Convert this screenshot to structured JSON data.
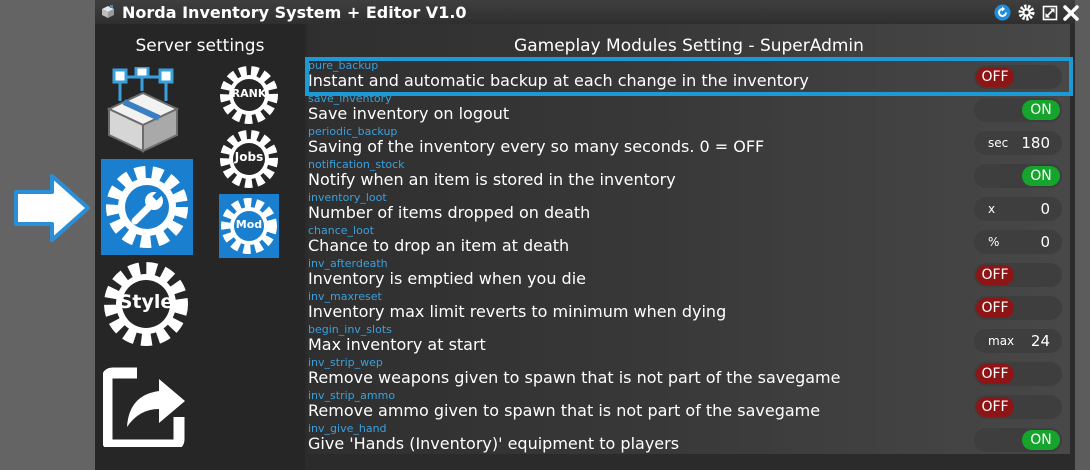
{
  "window": {
    "title": "Norda Inventory System + Editor V1.0"
  },
  "sidebar": {
    "heading": "Server settings",
    "items": [
      {
        "id": "inventory",
        "icon": "inventory-box-icon"
      },
      {
        "id": "settings",
        "icon": "settings-gear-wrench-icon",
        "active": true
      },
      {
        "id": "style",
        "icon": "style-gear-icon",
        "label": "Style"
      },
      {
        "id": "share",
        "icon": "share-export-icon"
      },
      {
        "id": "rank",
        "icon": "rank-gear-icon",
        "label": "RANK"
      },
      {
        "id": "jobs",
        "icon": "jobs-gear-icon",
        "label": "Jobs"
      },
      {
        "id": "mod",
        "icon": "mod-gear-icon",
        "label": "Mod",
        "active": true
      }
    ]
  },
  "content": {
    "title": "Gameplay Modules Setting - SuperAdmin",
    "rows": [
      {
        "key": "pure_backup",
        "desc": "Instant and automatic backup at each change in the inventory",
        "type": "toggle",
        "value": "OFF"
      },
      {
        "key": "save_inventory",
        "desc": "Save inventory on logout",
        "type": "toggle",
        "value": "ON"
      },
      {
        "key": "periodic_backup",
        "desc": "Saving of the inventory every so many seconds. 0 = OFF",
        "type": "number",
        "unit": "sec",
        "value": "180"
      },
      {
        "key": "notification_stock",
        "desc": "Notify when an item is stored in the inventory",
        "type": "toggle",
        "value": "ON"
      },
      {
        "key": "inventory_loot",
        "desc": "Number of items dropped on death",
        "type": "number",
        "unit": "x",
        "value": "0"
      },
      {
        "key": "chance_loot",
        "desc": "Chance to drop an item at death",
        "type": "number",
        "unit": "%",
        "value": "0"
      },
      {
        "key": "inv_afterdeath",
        "desc": "Inventory is emptied when you die",
        "type": "toggle",
        "value": "OFF"
      },
      {
        "key": "inv_maxreset",
        "desc": "Inventory max limit reverts to minimum when dying",
        "type": "toggle",
        "value": "OFF"
      },
      {
        "key": "begin_inv_slots",
        "desc": "Max inventory at start",
        "type": "number",
        "unit": "max",
        "value": "24"
      },
      {
        "key": "inv_strip_wep",
        "desc": "Remove weapons given to spawn that is not part of the savegame",
        "type": "toggle",
        "value": "OFF"
      },
      {
        "key": "inv_strip_ammo",
        "desc": "Remove ammo given to spawn that is not part of the savegame",
        "type": "toggle",
        "value": "OFF"
      },
      {
        "key": "inv_give_hand",
        "desc": "Give 'Hands (Inventory)' equipment to players",
        "type": "toggle",
        "value": "ON"
      }
    ]
  },
  "colors": {
    "accent": "#1c9ad6",
    "on": "#16a52c",
    "off": "#8e1515",
    "key_text": "#3aa0dc"
  }
}
